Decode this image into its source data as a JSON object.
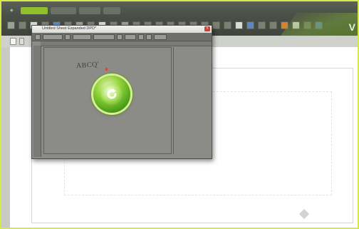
{
  "menubar": {
    "tabs": [
      {
        "label": "◆",
        "active": false,
        "plain": true
      },
      {
        "label": "",
        "active": true,
        "plain": false
      },
      {
        "label": "",
        "active": false,
        "plain": false
      },
      {
        "label": "",
        "active": false,
        "plain": false
      },
      {
        "label": "",
        "active": false,
        "plain": false
      }
    ]
  },
  "brand": {
    "letter": "V"
  },
  "dialog": {
    "title": "Untitled Sheet Expanded DPD*",
    "close_label": "×",
    "sample_text": "ABCQ'"
  },
  "colors": {
    "ribbon": "#4b5048",
    "accent_green": "#8fbf2a",
    "dialog_bg": "#8b8b88",
    "page_border": "#d4d6d2",
    "screen_border": "#d6e84a"
  },
  "icons": {
    "reload": "reload-icon",
    "close": "close-icon"
  }
}
